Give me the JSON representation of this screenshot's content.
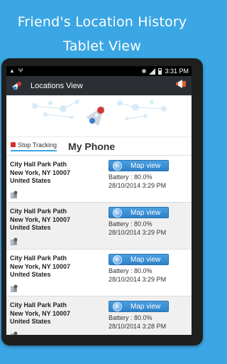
{
  "promo": {
    "line1": "Friend's Location History",
    "line2": "Tablet View"
  },
  "statusbar": {
    "time": "3:31 PM"
  },
  "actionbar": {
    "title": "Locations View"
  },
  "tabs": {
    "stop_label": "Stop Tracking",
    "phone_label": "My Phone"
  },
  "entries": [
    {
      "line1": "City Hall Park Path",
      "line2": "New York, NY 10007",
      "line3": "United States",
      "button": "Map view",
      "battery": "Battery : 80.0%",
      "datetime": "28/10/2014 3:29 PM"
    },
    {
      "line1": "City Hall Park Path",
      "line2": "New York, NY 10007",
      "line3": "United States",
      "button": "Map view",
      "battery": "Battery : 80.0%",
      "datetime": "28/10/2014 3:29 PM"
    },
    {
      "line1": "City Hall Park Path",
      "line2": "New York, NY 10007",
      "line3": "United States",
      "button": "Map view",
      "battery": "Battery : 80.0%",
      "datetime": "28/10/2014 3:29 PM"
    },
    {
      "line1": "City Hall Park Path",
      "line2": "New York, NY 10007",
      "line3": "United States",
      "button": "Map view",
      "battery": "Battery : 80.0%",
      "datetime": "28/10/2014 3:28 PM"
    }
  ],
  "colors": {
    "background": "#3ba6e4",
    "button": "#3a8fd6",
    "stop": "#d32f2f"
  }
}
